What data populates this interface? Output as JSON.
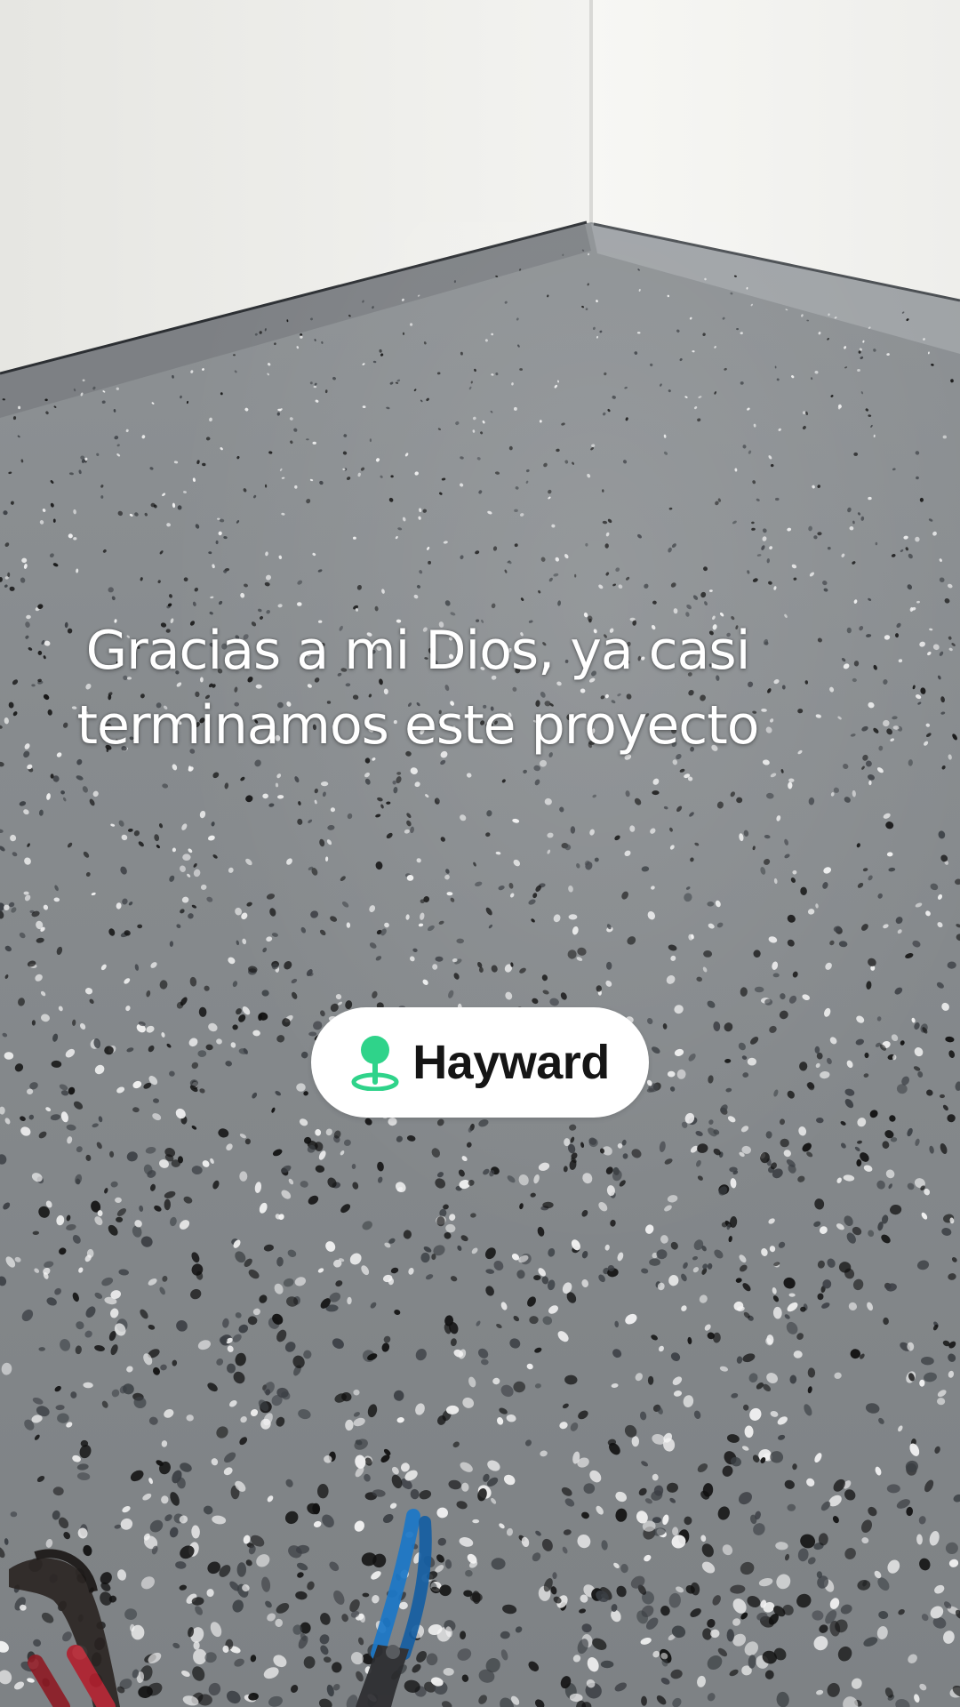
{
  "caption": {
    "line1": "Gracias a mi Dios, ya casi",
    "line2": "terminamos este proyecto"
  },
  "location_sticker": {
    "place": "Hayward",
    "icon": "location-pin-icon",
    "accent_color": "#2fd38a"
  },
  "scene": {
    "wall_color": "#f2f2ef",
    "floor_color": "#8a8e91",
    "flake_colors": [
      "#111111",
      "#f4f4f4",
      "#3b3f44"
    ]
  }
}
